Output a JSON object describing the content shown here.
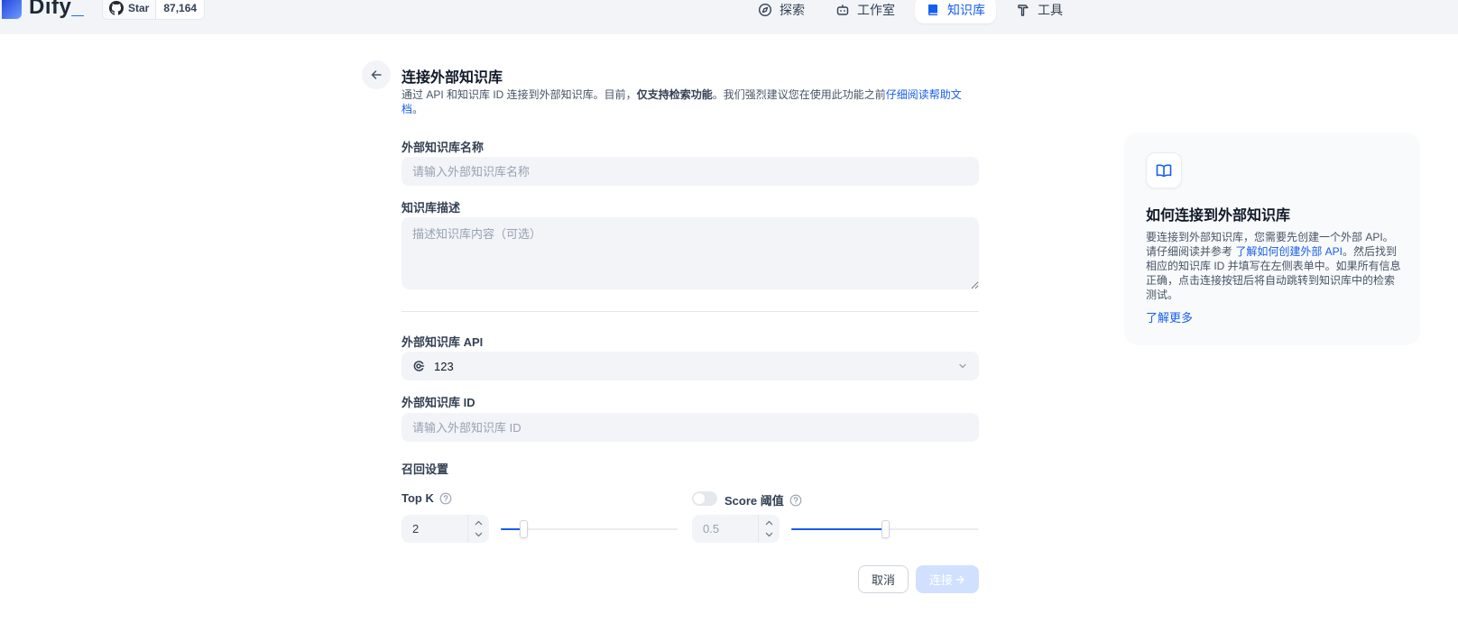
{
  "header": {
    "logo_text": "Dify",
    "github": {
      "label": "Star",
      "count": "87,164"
    },
    "nav": [
      {
        "label": "探索",
        "icon": "compass-icon"
      },
      {
        "label": "工作室",
        "icon": "robot-icon"
      },
      {
        "label": "知识库",
        "icon": "book-icon",
        "active": true
      },
      {
        "label": "工具",
        "icon": "hammer-icon"
      }
    ]
  },
  "form": {
    "title": "连接外部知识库",
    "description_pre": "通过 API 和知识库 ID 连接到外部知识库。目前，",
    "description_bold": "仅支持检索功能",
    "description_post": "。我们强烈建议您在使用此功能之前",
    "description_link": "仔细阅读帮助文档",
    "description_end": "。",
    "name_label": "外部知识库名称",
    "name_placeholder": "请输入外部知识库名称",
    "desc_label": "知识库描述",
    "desc_placeholder": "描述知识库内容（可选）",
    "api_label": "外部知识库 API",
    "api_value": "123",
    "id_label": "外部知识库 ID",
    "id_placeholder": "请输入外部知识库 ID",
    "retrieval_title": "召回设置",
    "top_k": {
      "label": "Top K",
      "value": "2",
      "level": 0.13
    },
    "score": {
      "label": "Score 阈值",
      "value": "0.5",
      "level": 0.5,
      "enabled": false
    },
    "cancel_label": "取消",
    "connect_label": "连接"
  },
  "help_panel": {
    "title": "如何连接到外部知识库",
    "text_pre": "要连接到外部知识库，您需要先创建一个外部 API。请仔细阅读并参考 ",
    "text_link": "了解如何创建外部 API",
    "text_post": "。然后找到相应的知识库 ID 并填写在左侧表单中。如果所有信息正确，点击连接按钮后将自动跳转到知识库中的检索测试。",
    "learn_more": "了解更多"
  },
  "colors": {
    "accent": "#155eef",
    "panel_bg": "#f9fafb",
    "input_bg": "#f2f4f7"
  }
}
